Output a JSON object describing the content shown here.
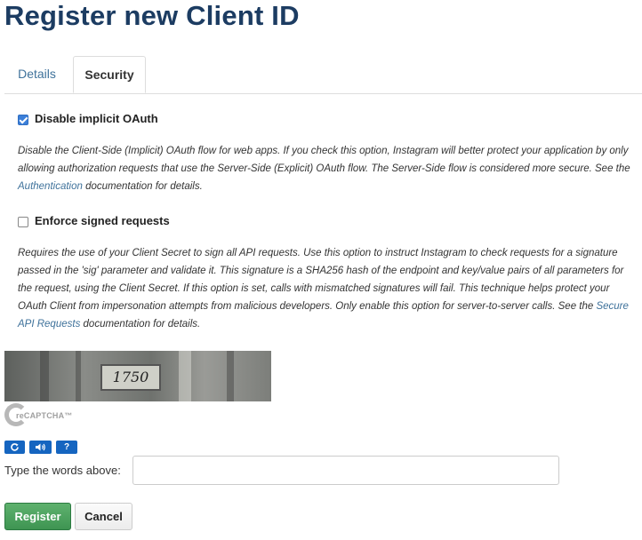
{
  "page": {
    "title": "Register new Client ID"
  },
  "tabs": [
    {
      "label": "Details",
      "active": false
    },
    {
      "label": "Security",
      "active": true
    }
  ],
  "options": {
    "implicit": {
      "label": "Disable implicit OAuth",
      "checked": true,
      "desc_before": "Disable the Client-Side (Implicit) OAuth flow for web apps. If you check this option, Instagram will better protect your application by only allowing authorization requests that use the Server-Side (Explicit) OAuth flow. The Server-Side flow is considered more secure. See the ",
      "link": "Authentication",
      "desc_after": " documentation for details."
    },
    "signed": {
      "label": "Enforce signed requests",
      "checked": false,
      "desc_before": "Requires the use of your Client Secret to sign all API requests. Use this option to instruct Instagram to check requests for a signature passed in the 'sig' parameter and validate it. This signature is a SHA256 hash of the endpoint and key/value pairs of all parameters for the request, using the Client Secret. If this option is set, calls with mismatched signatures will fail. This technique helps protect your OAuth Client from impersonation attempts from malicious developers. Only enable this option for server-to-server calls. See the ",
      "link": "Secure API Requests",
      "desc_after": " documentation for details."
    }
  },
  "captcha": {
    "image_text": "1750",
    "logo_text": "reCAPTCHA™",
    "buttons": {
      "reload_icon": "reload-icon",
      "audio_icon": "audio-icon",
      "help_label": "?"
    },
    "prompt": "Type the words above:",
    "input_value": "",
    "input_placeholder": ""
  },
  "actions": {
    "register": "Register",
    "cancel": "Cancel"
  },
  "colors": {
    "title": "#1c3c62",
    "link": "#3f729b",
    "register": "#4a9d5b",
    "captcha_button": "#1565c0"
  }
}
